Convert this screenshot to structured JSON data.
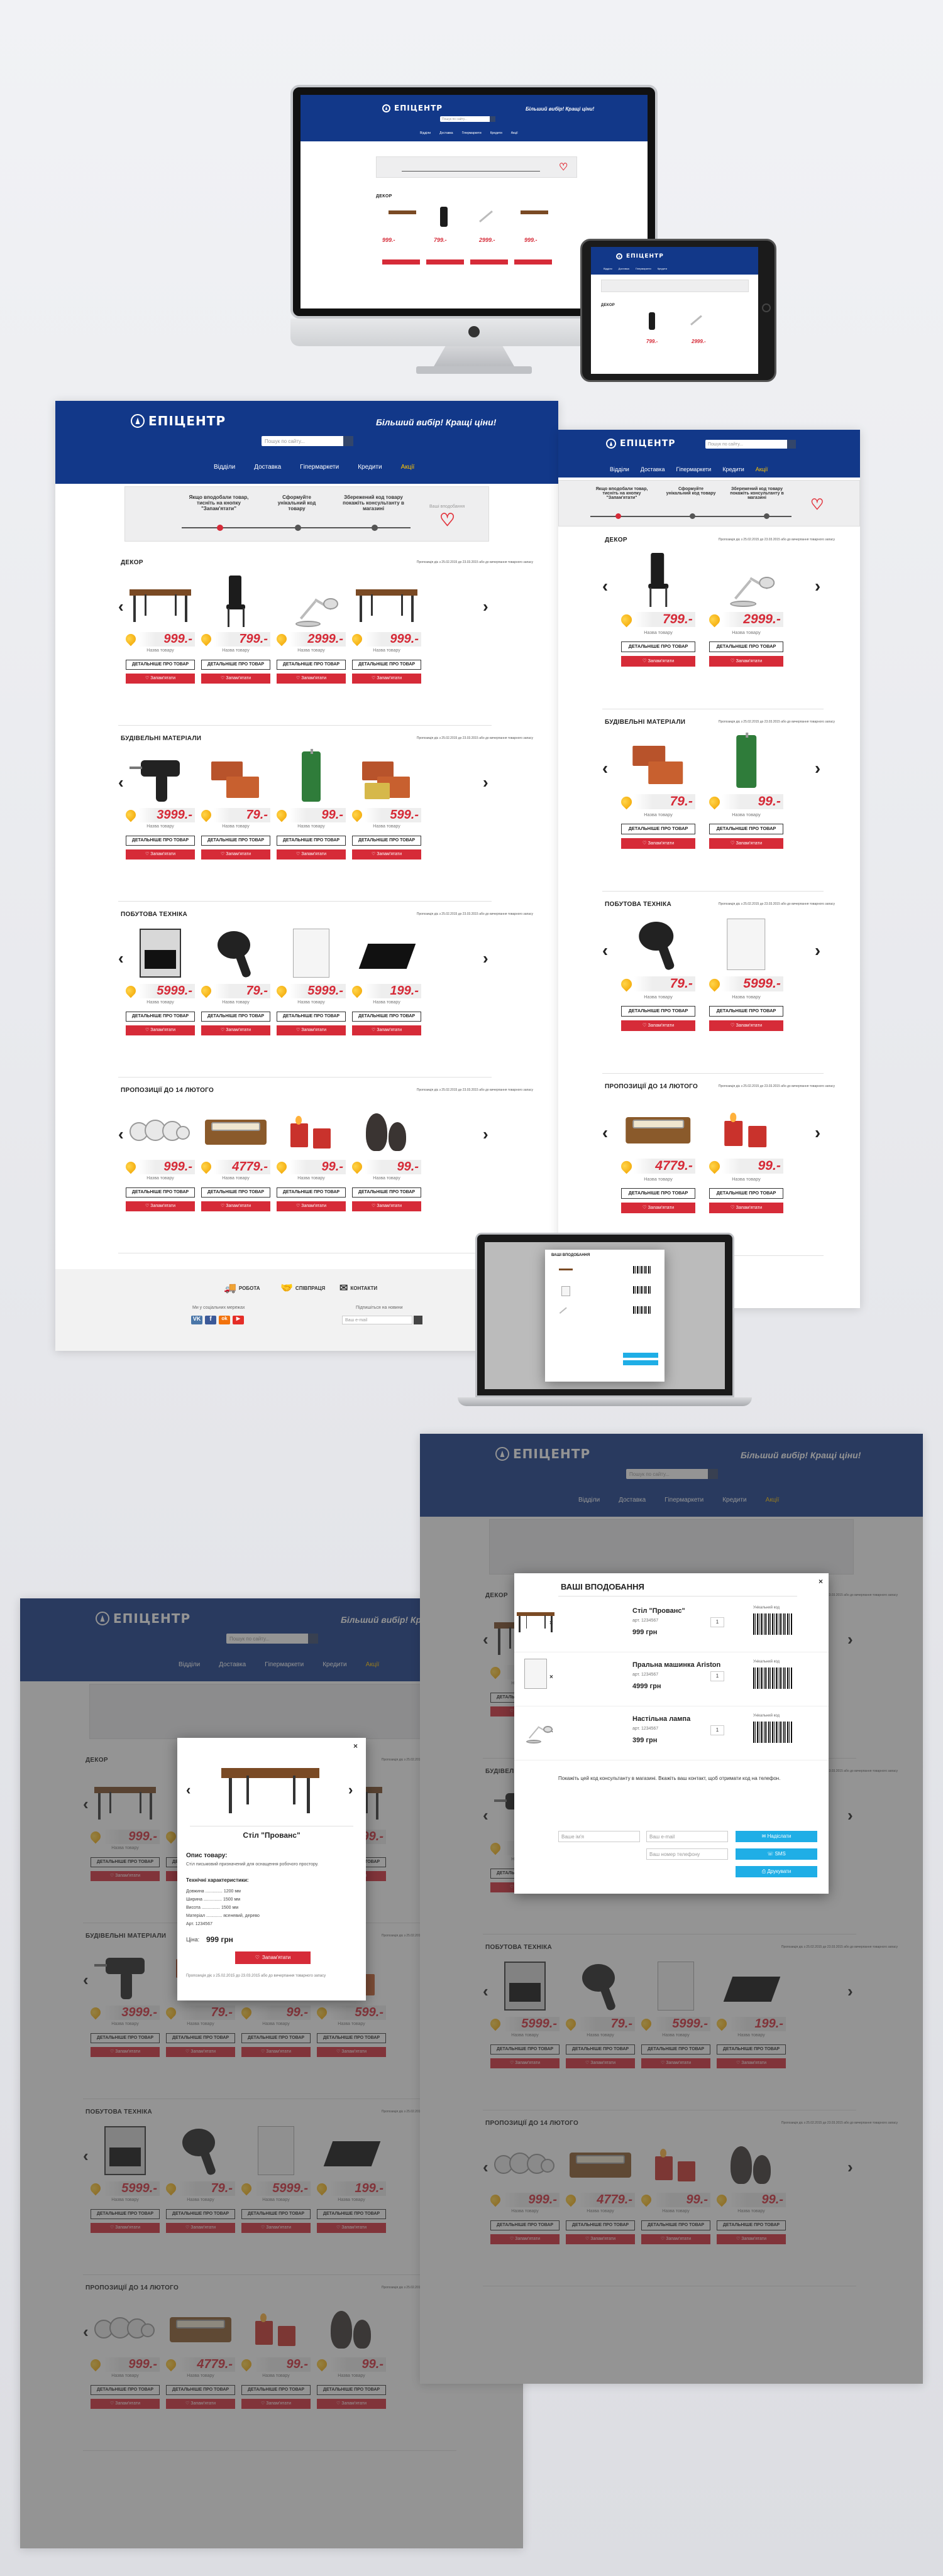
{
  "brand": {
    "logo": "ЕПІЦЕНТР",
    "slogan": "Більший вибір! Кращі ціни!",
    "colors": {
      "header": "#123889",
      "accent_red": "#d62b38",
      "price_drop": "#f2a400",
      "cta_blue": "#1faee6"
    }
  },
  "search": {
    "placeholder": "Пошук по сайту..."
  },
  "nav": [
    "Відділи",
    "Доставка",
    "Гіпермаркети",
    "Кредити",
    "Акції"
  ],
  "promo": {
    "steps": [
      "Якщо вподобали товар, тисніть на кнопку \"Запам'ятати\"",
      "Сформуйте унікальний код товару",
      "Збережений код товару покажіть консультанту в магазині"
    ],
    "right_label": "Ваші вподобання"
  },
  "section_note": "Пропозиція діє з 25.02.2015 до 23.03.2015 або до вичерпання товарного запасу",
  "labels": {
    "detail_button": "ДЕТАЛЬНІШЕ ПРО ТОВАР",
    "remember_button": "Запам'ятати",
    "product_note": "Назва товару"
  },
  "sections": [
    {
      "title": "ДЕКОР",
      "prices": [
        "999.-",
        "799.-",
        "2999.-",
        "999.-"
      ]
    },
    {
      "title": "БУДІВЕЛЬНІ МАТЕРІАЛИ",
      "prices": [
        "3999.-",
        "79.-",
        "99.-",
        "599.-"
      ]
    },
    {
      "title": "ПОБУТОВА ТЕХНІКА",
      "prices": [
        "5999.-",
        "79.-",
        "5999.-",
        "199.-"
      ]
    },
    {
      "title": "ПРОПОЗИЦІЇ ДО 14 ЛЮТОГО",
      "prices": [
        "999.-",
        "4779.-",
        "99.-",
        "99.-"
      ]
    }
  ],
  "mobile_sections": [
    {
      "title": "ДЕКОР",
      "prices": [
        "799.-",
        "2999.-"
      ]
    },
    {
      "title": "БУДІВЕЛЬНІ МАТЕРІАЛИ",
      "prices": [
        "79.-",
        "99.-"
      ]
    },
    {
      "title": "ПОБУТОВА ТЕХНІКА",
      "prices": [
        "79.-",
        "5999.-"
      ]
    },
    {
      "title": "ПРОПОЗИЦІЇ ДО 14 ЛЮТОГО",
      "prices": [
        "4779.-",
        "99.-"
      ]
    }
  ],
  "footer": {
    "links": [
      "РОБОТА",
      "СПІВПРАЦЯ",
      "КОНТАКТИ"
    ],
    "social_title": "Ми у соціальних мережах",
    "subscribe_title": "Підпишіться на новини",
    "subscribe_placeholder": "Ваш e-mail",
    "social": [
      "VK",
      "f",
      "ok",
      "▶"
    ]
  },
  "product_modal": {
    "name": "Стіл \"Прованс\"",
    "desc_title": "Опис товару:",
    "desc": "Стіл письмовий призначений для оснащення робочого простору.",
    "spec_title": "Технічні характеристики:",
    "specs": [
      "Довжина .............. 1200 мм",
      "Ширина ............... 1500 мм",
      "Висота ............... 1500 мм",
      "Матеріал ............. ясеневий, дерево",
      "Арт. 1234567"
    ],
    "price_label": "Ціна:",
    "price": "999 грн",
    "remember": "Запам'ятати",
    "footnote": "Пропозиція діє з 25.02.2015 до 23.03.2015 або до вичерпання товарного запасу"
  },
  "wishlist_modal": {
    "title": "ВАШІ ВПОДОБАННЯ",
    "items": [
      {
        "name": "Стіл \"Прованс\"",
        "code": "арт. 1234567",
        "price": "999 грн",
        "qty": "1",
        "barcode_label": "Унікальний код"
      },
      {
        "name": "Пральна машинка Ariston",
        "code": "арт. 1234567",
        "price": "4999 грн",
        "qty": "1",
        "barcode_label": "Унікальний код"
      },
      {
        "name": "Настільна лампа",
        "code": "арт. 1234567",
        "price": "399 грн",
        "qty": "1",
        "barcode_label": "Унікальний код"
      }
    ],
    "note": "Покажіть цей код консультанту в магазині. Вкажіть ваш контакт, щоб отримати код на телефон.",
    "name_placeholder": "Ваше ім'я",
    "email_placeholder": "Ваш e-mail",
    "phone_placeholder": "Ваш номер телефону",
    "send": "Надіслати",
    "sms": "SMS",
    "print": "Друкувати"
  }
}
